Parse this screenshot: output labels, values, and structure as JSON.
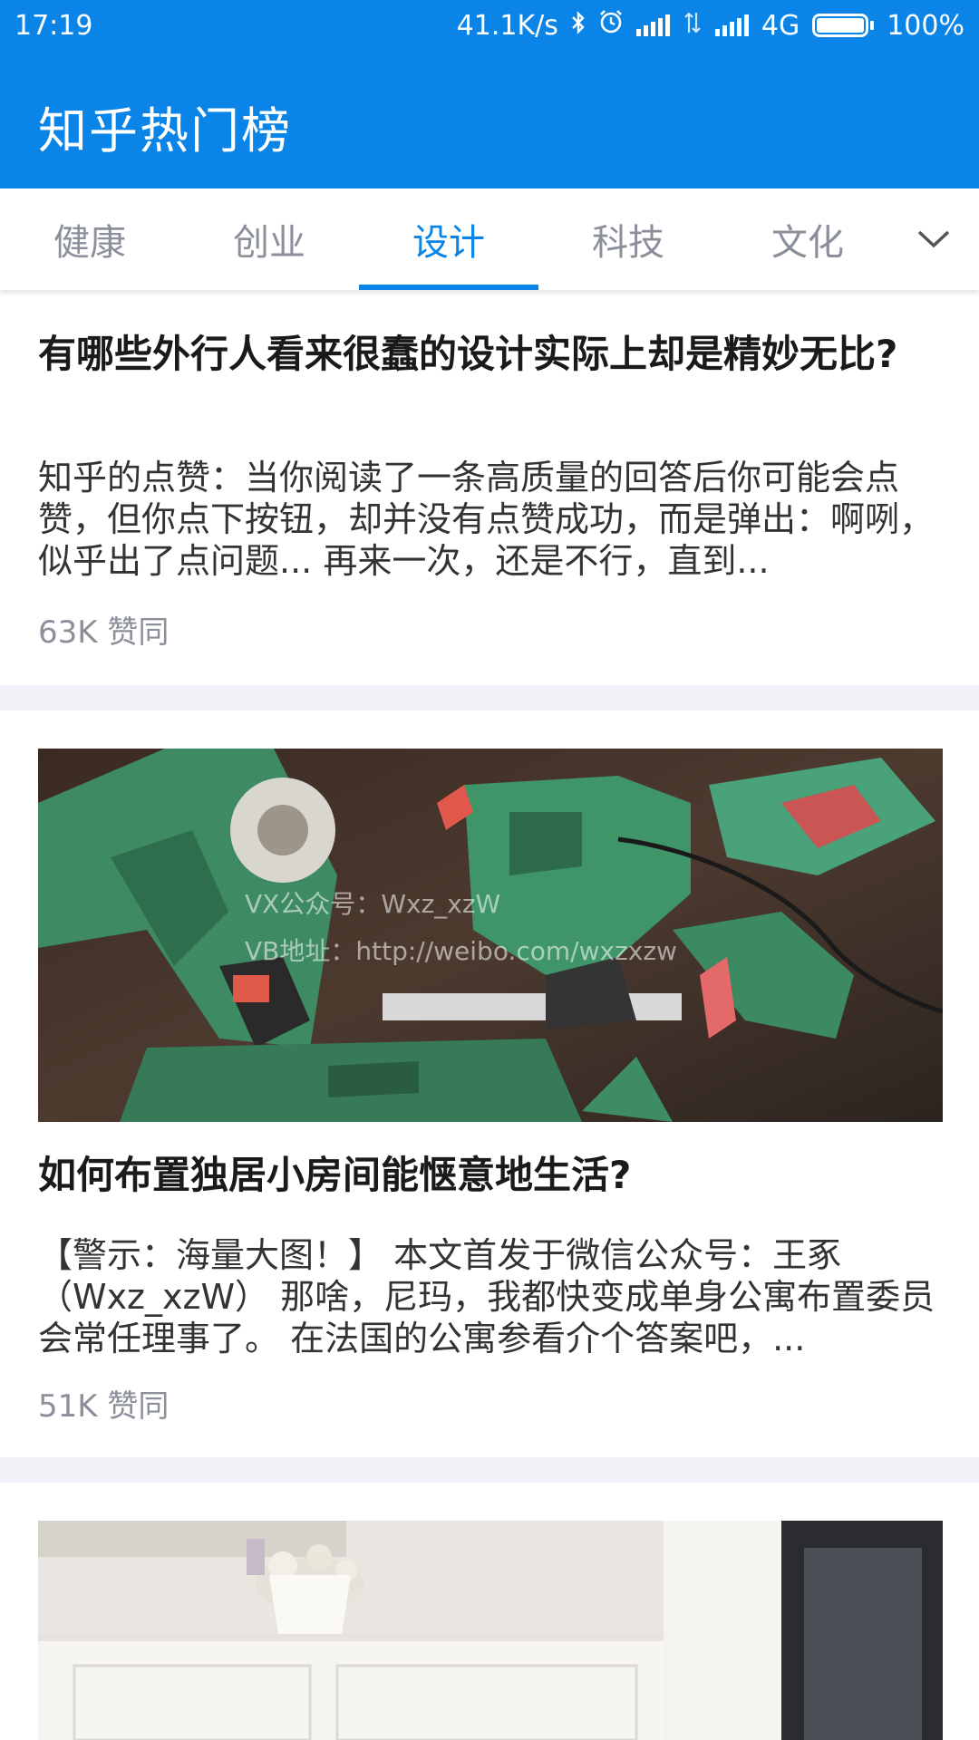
{
  "status_bar": {
    "time": "17:19",
    "net_speed": "41.1K/s",
    "network": "4G",
    "battery": "100%",
    "battery_level": 1.0,
    "icons": [
      "bluetooth-icon",
      "alarm-icon",
      "signal-icon",
      "data-arrows-icon",
      "signal-icon",
      "battery-icon"
    ]
  },
  "app_bar": {
    "title": "知乎热门榜"
  },
  "tabs": [
    {
      "label": "健康",
      "active": false
    },
    {
      "label": "创业",
      "active": false
    },
    {
      "label": "设计",
      "active": true
    },
    {
      "label": "科技",
      "active": false
    },
    {
      "label": "文化",
      "active": false
    }
  ],
  "tabs_more_icon": "chevron-down-icon",
  "colors": {
    "primary": "#0a84e6",
    "text": "#1a1a1a",
    "muted": "#8a8f99",
    "divider": "#f0f2f7"
  },
  "cards": [
    {
      "title": "有哪些外行人看来很蠢的设计实际上却是精妙无比?",
      "excerpt": "知乎的点赞：当你阅读了一条高质量的回答后你可能会点赞，但你点下按钮，却并没有点赞成功，而是弹出：啊咧，似乎出了点问题... 再来一次，还是不行，直到...",
      "votes": "63K 赞同"
    },
    {
      "image_watermark": [
        "VX公众号：Wxz_xzW",
        "VB地址：http://weibo.com/wxzxzw"
      ],
      "title": "如何布置独居小房间能惬意地生活?",
      "excerpt": "【警示：海量大图！】 本文首发于微信公众号：王豖（Wxz_xzW） 那啥，尼玛，我都快变成单身公寓布置委员会常任理事了。 在法国的公寓参看介个答案吧，...",
      "votes": "51K 赞同"
    }
  ]
}
